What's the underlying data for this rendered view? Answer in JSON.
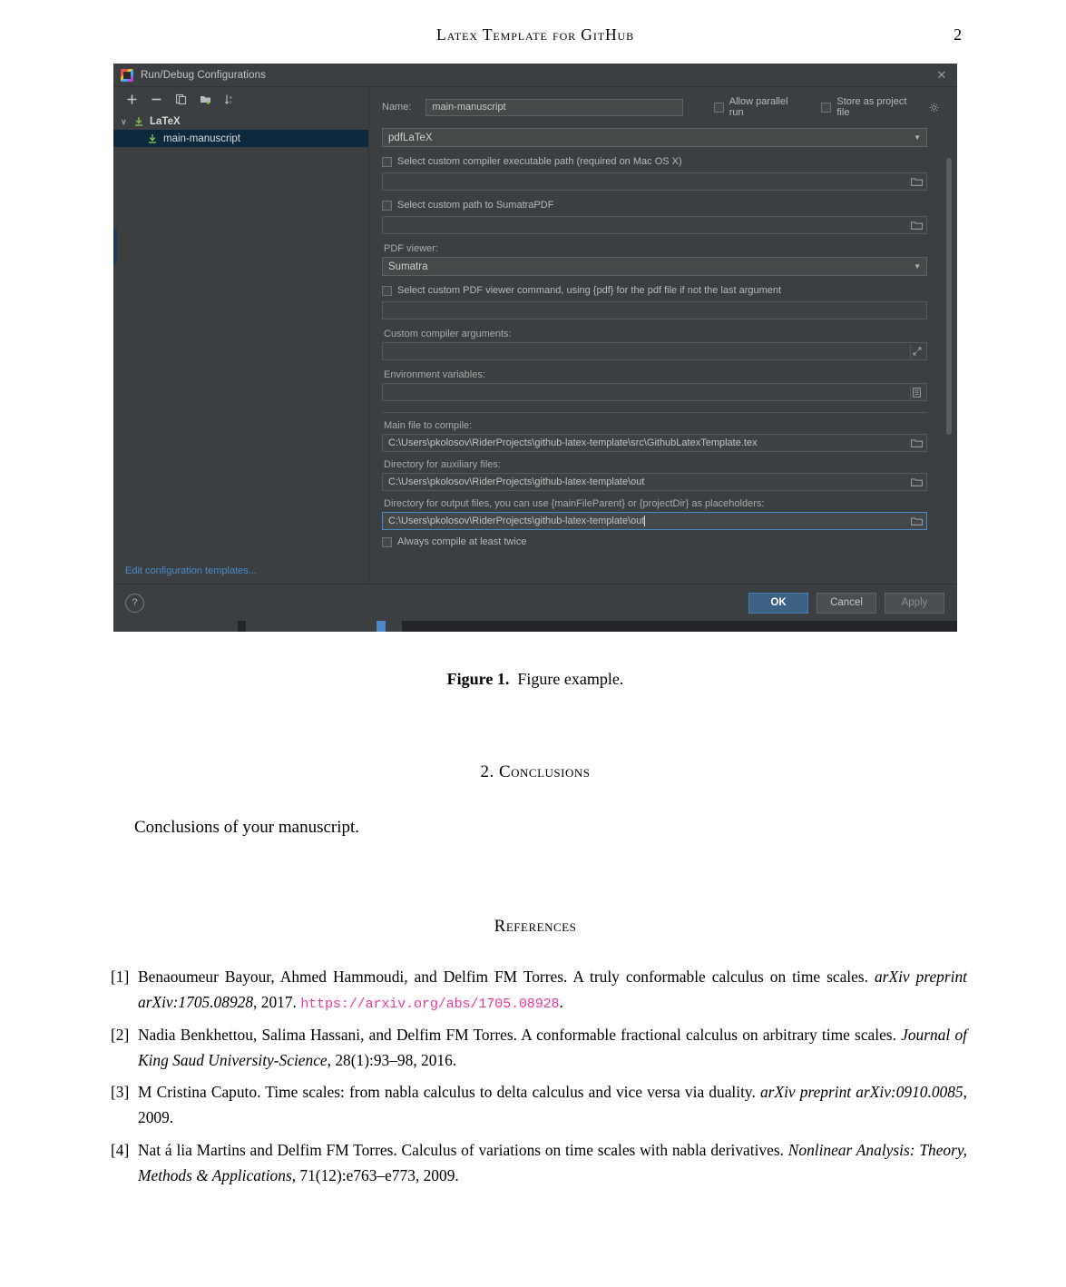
{
  "page": {
    "running_title": "Latex Template for GitHub",
    "page_number": "2"
  },
  "figure": {
    "label": "Figure 1.",
    "caption": "Figure example."
  },
  "dialog": {
    "title": "Run/Debug Configurations",
    "close_label": "✕",
    "toolbar": {
      "add": "add-icon",
      "remove": "remove-icon",
      "copy": "copy-icon",
      "folder": "new-folder-icon",
      "sort": "sort-icon"
    },
    "tree": {
      "group_label": "LaTeX",
      "child_label": "main-manuscript",
      "chevron": "∨"
    },
    "edit_templates_link": "Edit configuration templates...",
    "name_label": "Name:",
    "name_value": "main-manuscript",
    "allow_parallel_run": "Allow parallel run",
    "store_as_project_file": "Store as project file",
    "compiler_value": "pdfLaTeX",
    "custom_compiler_path_label": "Select custom compiler executable path (required on Mac OS X)",
    "custom_compiler_path_value": "",
    "custom_sumatra_label": "Select custom path to SumatraPDF",
    "custom_sumatra_value": "",
    "pdf_viewer_label": "PDF viewer:",
    "pdf_viewer_value": "Sumatra",
    "custom_pdf_cmd_label": "Select custom PDF viewer command, using {pdf} for the pdf file if not the last argument",
    "custom_pdf_cmd_value": "",
    "custom_compiler_args_label": "Custom compiler arguments:",
    "custom_compiler_args_value": "",
    "env_vars_label": "Environment variables:",
    "env_vars_value": "",
    "main_file_label": "Main file to compile:",
    "main_file_value": "C:\\Users\\pkolosov\\RiderProjects\\github-latex-template\\src\\GithubLatexTemplate.tex",
    "aux_dir_label": "Directory for auxiliary files:",
    "aux_dir_value": "C:\\Users\\pkolosov\\RiderProjects\\github-latex-template\\out",
    "out_dir_label": "Directory for output files, you can use {mainFileParent} or {projectDir} as placeholders:",
    "out_dir_value": "C:\\Users\\pkolosov\\RiderProjects\\github-latex-template\\out",
    "always_compile_twice": "Always compile at least twice",
    "help_label": "?",
    "ok_label": "OK",
    "cancel_label": "Cancel",
    "apply_label": "Apply",
    "colors": {
      "background": "#3c3f41",
      "selection": "#0d293e",
      "accent": "#4a88c7",
      "primary_button": "#3d6185"
    }
  },
  "sections": {
    "conclusions_heading": "2.  Conclusions",
    "conclusions_text": "Conclusions of your manuscript.",
    "references_heading": "References"
  },
  "references": [
    {
      "num": "[1]",
      "pre": "Benaoumeur Bayour, Ahmed Hammoudi, and Delfim FM Torres. A truly conformable calculus on time scales. ",
      "italic": "arXiv preprint arXiv:1705.08928",
      "mid": ", 2017. ",
      "url": "https://arxiv.org/abs/1705.08928",
      "post": "."
    },
    {
      "num": "[2]",
      "pre": "Nadia Benkhettou, Salima Hassani, and Delfim FM Torres. A conformable fractional calculus on arbitrary time scales. ",
      "italic": "Journal of King Saud University-Science",
      "mid": ", 28(1):93–98, 2016.",
      "url": "",
      "post": ""
    },
    {
      "num": "[3]",
      "pre": "M Cristina Caputo. Time scales: from nabla calculus to delta calculus and vice versa via duality. ",
      "italic": "arXiv preprint arXiv:0910.0085",
      "mid": ", 2009.",
      "url": "",
      "post": ""
    },
    {
      "num": "[4]",
      "pre": "Nat á lia Martins and Delfim FM Torres. Calculus of variations on time scales with nabla derivatives. ",
      "italic": "Nonlinear Analysis: Theory, Methods & Applications",
      "mid": ", 71(12):e763–e773, 2009.",
      "url": "",
      "post": ""
    }
  ]
}
